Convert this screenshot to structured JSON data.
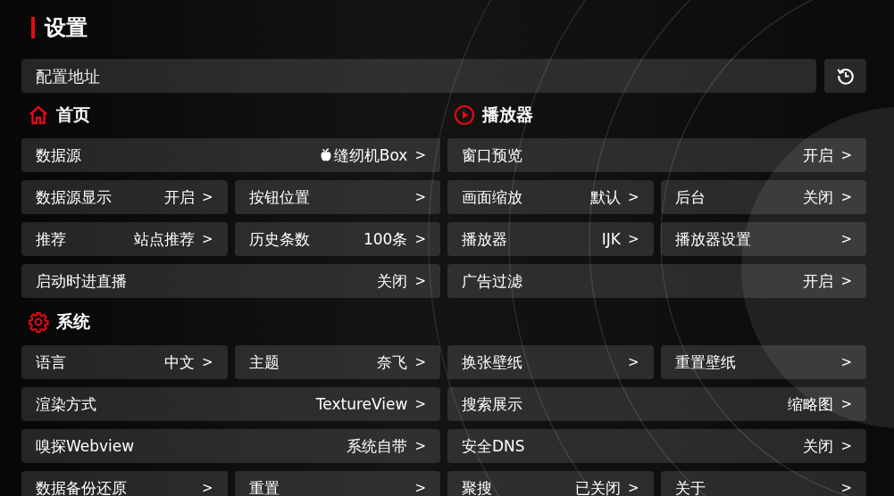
{
  "title": "设置",
  "config": {
    "placeholder": "配置地址"
  },
  "columns": [
    {
      "sections": [
        {
          "kind": "home",
          "title": "首页",
          "rows": [
            [
              {
                "kind": "source",
                "label": "数据源",
                "value": "缝纫机Box",
                "chevron": ">"
              }
            ],
            [
              {
                "kind": "option",
                "label": "数据源显示",
                "value": "开启",
                "chevron": ">"
              },
              {
                "kind": "option",
                "label": "按钮位置",
                "chevron": ">"
              }
            ],
            [
              {
                "kind": "option",
                "label": "推荐",
                "value": "站点推荐",
                "chevron": ">"
              },
              {
                "kind": "option",
                "label": "历史条数",
                "value": "100条",
                "chevron": ">"
              }
            ],
            [
              {
                "kind": "option",
                "label": "启动时进直播",
                "value": "关闭",
                "chevron": ">"
              }
            ]
          ]
        },
        {
          "kind": "system",
          "title": "系统",
          "rows": [
            [
              {
                "kind": "option",
                "label": "语言",
                "value": "中文",
                "chevron": ">"
              },
              {
                "kind": "option",
                "label": "主题",
                "value": "奈飞",
                "chevron": ">"
              }
            ],
            [
              {
                "kind": "option",
                "label": "渲染方式",
                "value": "TextureView",
                "chevron": ">"
              }
            ],
            [
              {
                "kind": "option",
                "label": "嗅探Webview",
                "value": "系统自带",
                "chevron": ">"
              }
            ],
            [
              {
                "kind": "option",
                "label": "数据备份还原",
                "chevron": ">"
              },
              {
                "kind": "option",
                "label": "重置",
                "chevron": ">"
              }
            ]
          ]
        }
      ]
    },
    {
      "sections": [
        {
          "kind": "player",
          "title": "播放器",
          "rows": [
            [
              {
                "kind": "option",
                "label": "窗口预览",
                "value": "开启",
                "chevron": ">"
              }
            ],
            [
              {
                "kind": "option",
                "label": "画面缩放",
                "value": "默认",
                "chevron": ">"
              },
              {
                "kind": "option",
                "label": "后台",
                "value": "关闭",
                "chevron": ">"
              }
            ],
            [
              {
                "kind": "option",
                "label": "播放器",
                "value": "IJK",
                "chevron": ">"
              },
              {
                "kind": "option",
                "label": "播放器设置",
                "chevron": ">"
              }
            ],
            [
              {
                "kind": "option",
                "label": "广告过滤",
                "value": "开启",
                "chevron": ">"
              }
            ],
            [
              {
                "kind": "option",
                "label": "换张壁纸",
                "chevron": ">"
              },
              {
                "kind": "option",
                "label": "重置壁纸",
                "chevron": ">"
              }
            ],
            [
              {
                "kind": "option",
                "label": "搜索展示",
                "value": "缩略图",
                "chevron": ">"
              }
            ],
            [
              {
                "kind": "option",
                "label": "安全DNS",
                "value": "关闭",
                "chevron": ">"
              }
            ],
            [
              {
                "kind": "option",
                "label": "聚搜",
                "value": "已关闭",
                "chevron": ">"
              },
              {
                "kind": "option",
                "label": "关于",
                "chevron": ">"
              }
            ]
          ]
        }
      ]
    }
  ]
}
